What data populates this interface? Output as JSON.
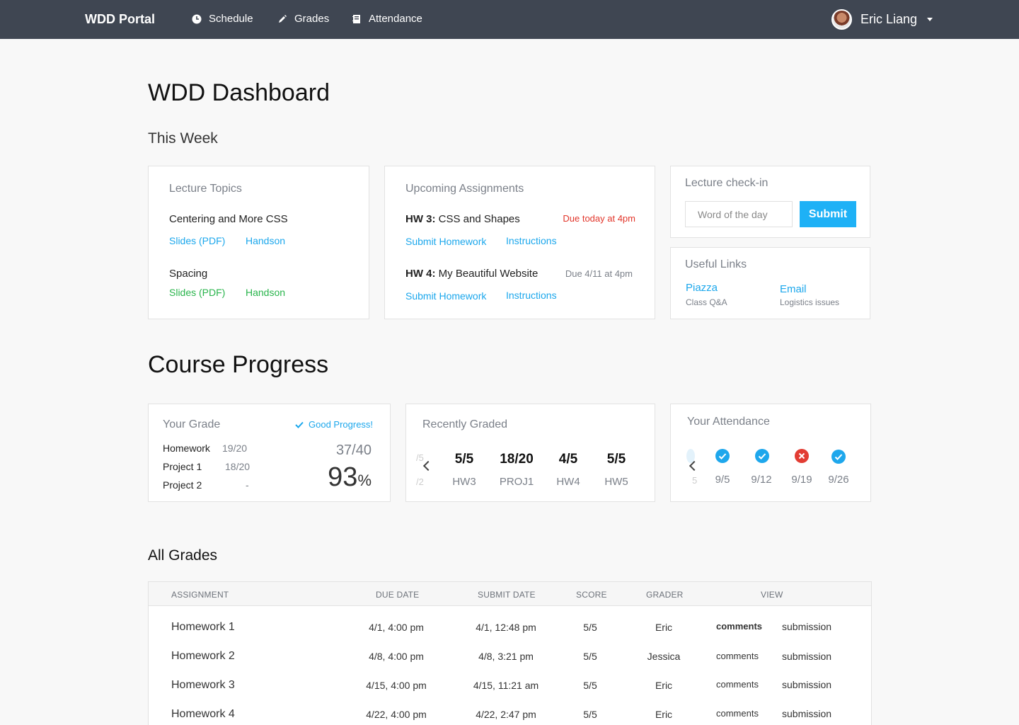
{
  "nav": {
    "brand": "WDD Portal",
    "items": [
      {
        "label": "Schedule",
        "icon": "clock-icon"
      },
      {
        "label": "Grades",
        "icon": "pencil-icon"
      },
      {
        "label": "Attendance",
        "icon": "notebook-icon"
      }
    ],
    "user_name": "Eric Liang"
  },
  "page_title": "WDD Dashboard",
  "this_week": {
    "heading": "This Week",
    "lecture_topics": {
      "title": "Lecture Topics",
      "topics": [
        {
          "name": "Centering and More CSS",
          "slides": "Slides (PDF)",
          "handson": "Handson"
        },
        {
          "name": "Spacing",
          "slides": "Slides (PDF)",
          "handson": "Handson"
        }
      ]
    },
    "upcoming": {
      "title": "Upcoming Assignments",
      "items": [
        {
          "code": "HW 3:",
          "name": "CSS and Shapes",
          "due": "Due today at 4pm",
          "submit": "Submit Homework",
          "instructions": "Instructions"
        },
        {
          "code": "HW 4:",
          "name": "My Beautiful Website",
          "due": "Due 4/11 at 4pm",
          "submit": "Submit Homework",
          "instructions": "Instructions"
        }
      ]
    },
    "checkin": {
      "title": "Lecture check-in",
      "placeholder": "Word of the day",
      "submit": "Submit"
    },
    "useful_links": {
      "title": "Useful Links",
      "links": [
        {
          "label": "Piazza",
          "desc": "Class Q&A"
        },
        {
          "label": "Email",
          "desc": "Logistics issues"
        }
      ]
    }
  },
  "course_progress": {
    "heading": "Course Progress",
    "your_grade": {
      "title": "Your Grade",
      "status": "Good Progress!",
      "rows": [
        {
          "label": "Homework",
          "value": "19/20"
        },
        {
          "label": "Project 1",
          "value": "18/20"
        },
        {
          "label": "Project 2",
          "value": "-"
        }
      ],
      "total": "37/40",
      "percent": "93",
      "percent_sign": "%"
    },
    "recently_graded": {
      "title": "Recently Graded",
      "partial_prev": {
        "score": "/5",
        "label": "/2"
      },
      "items": [
        {
          "score": "5/5",
          "label": "HW3"
        },
        {
          "score": "18/20",
          "label": "PROJ1"
        },
        {
          "score": "4/5",
          "label": "HW4"
        },
        {
          "score": "5/5",
          "label": "HW5"
        }
      ]
    },
    "attendance": {
      "title": "Your Attendance",
      "partial_prev": "5",
      "items": [
        {
          "date": "9/5",
          "status": "present"
        },
        {
          "date": "9/12",
          "status": "present"
        },
        {
          "date": "9/19",
          "status": "absent"
        },
        {
          "date": "9/26",
          "status": "present"
        }
      ]
    }
  },
  "all_grades": {
    "heading": "All Grades",
    "columns": [
      "ASSIGNMENT",
      "DUE DATE",
      "SUBMIT DATE",
      "SCORE",
      "GRADER",
      "VIEW"
    ],
    "rows": [
      {
        "assignment": "Homework 1",
        "due": "4/1, 4:00 pm",
        "submit": "4/1, 12:48 pm",
        "score": "5/5",
        "grader": "Eric",
        "comments": "comments",
        "comments_active": true,
        "submission": "submission"
      },
      {
        "assignment": "Homework 2",
        "due": "4/8, 4:00 pm",
        "submit": "4/8, 3:21 pm",
        "score": "5/5",
        "grader": "Jessica",
        "comments": "comments",
        "comments_active": false,
        "submission": "submission"
      },
      {
        "assignment": "Homework 3",
        "due": "4/15, 4:00 pm",
        "submit": "4/15, 11:21 am",
        "score": "5/5",
        "grader": "Eric",
        "comments": "comments",
        "comments_active": false,
        "submission": "submission"
      },
      {
        "assignment": "Homework 4",
        "due": "4/22, 4:00 pm",
        "submit": "4/22, 2:47 pm",
        "score": "5/5",
        "grader": "Eric",
        "comments": "comments",
        "comments_active": false,
        "submission": "submission"
      }
    ]
  },
  "colors": {
    "navbar": "#3f4652",
    "link_blue": "#1ba7ec",
    "link_green": "#28b44b",
    "due_red": "#e2352a",
    "submit_button": "#1eb1f6"
  }
}
